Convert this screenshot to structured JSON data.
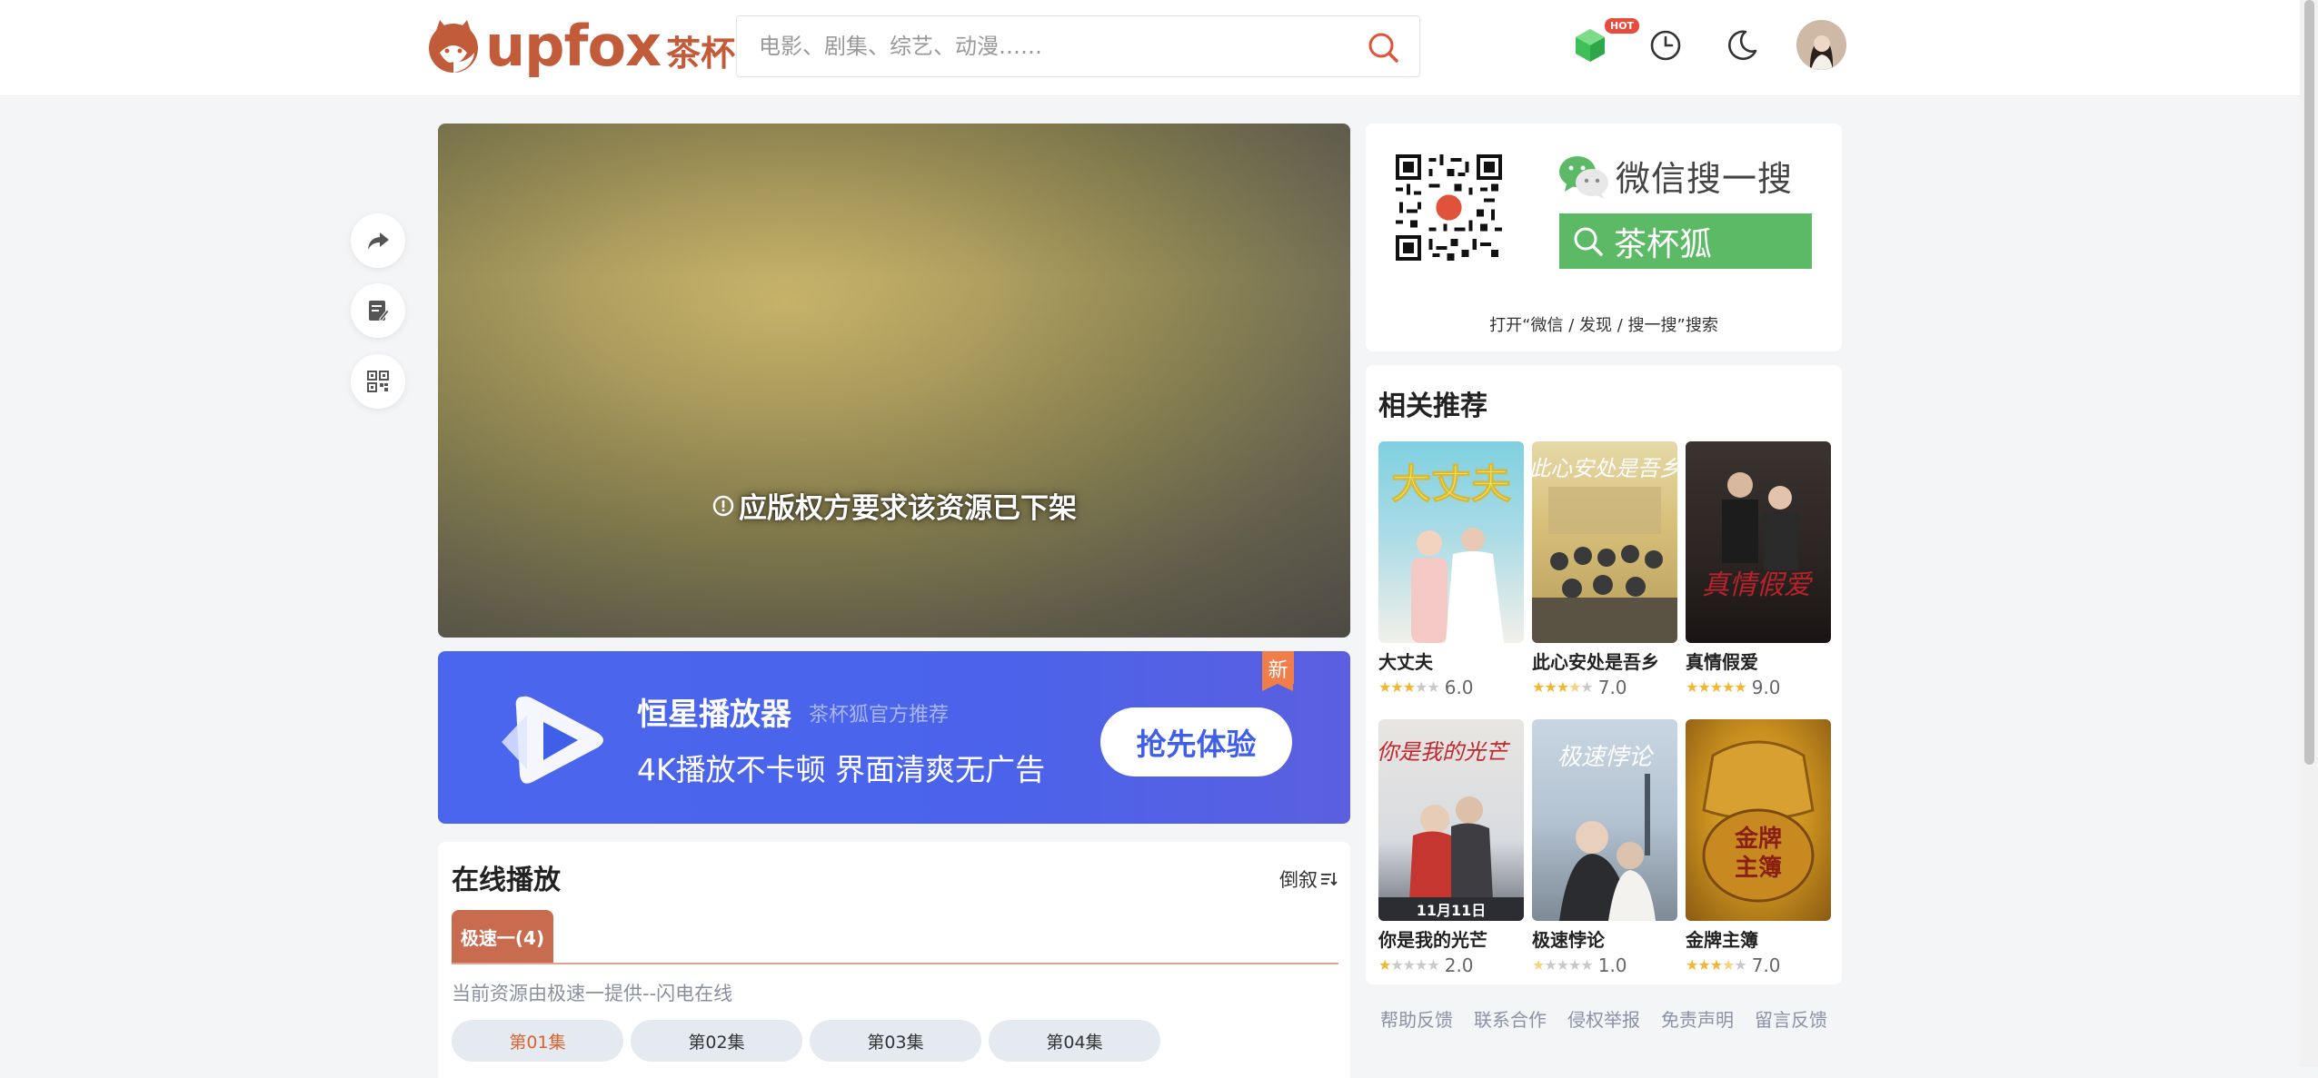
{
  "header": {
    "logo_text": "upfox",
    "logo_cn": "茶杯狐",
    "search_placeholder": "电影、剧集、综艺、动漫……",
    "hot_badge": "HOT"
  },
  "player": {
    "message": "应版权方要求该资源已下架"
  },
  "ad": {
    "title": "恒星播放器",
    "subtitle": "茶杯狐官方推荐",
    "description": "4K播放不卡顿  界面清爽无广告",
    "button": "抢先体验",
    "new_tag": "新"
  },
  "play": {
    "title": "在线播放",
    "sort_label": "倒叙",
    "source_tab": "极速一(4)",
    "source_info": "当前资源由极速一提供--闪电在线",
    "episodes": [
      "第01集",
      "第02集",
      "第03集",
      "第04集"
    ],
    "active_episode": 0
  },
  "wechat": {
    "title": "微信搜一搜",
    "search_text": "茶杯狐",
    "hint": "打开“微信 / 发现 / 搜一搜”搜索"
  },
  "recommend": {
    "title": "相关推荐",
    "items": [
      {
        "name": "大丈夫",
        "score": "6.0",
        "stars": 3
      },
      {
        "name": "此心安处是吾乡",
        "score": "7.0",
        "stars": 3.5
      },
      {
        "name": "真情假爱",
        "score": "9.0",
        "stars": 4.5
      },
      {
        "name": "你是我的光芒",
        "score": "2.0",
        "stars": 1
      },
      {
        "name": "极速悖论",
        "score": "1.0",
        "stars": 0.5
      },
      {
        "name": "金牌主簿",
        "score": "7.0",
        "stars": 3.5
      }
    ]
  },
  "footer": {
    "links": [
      "帮助反馈",
      "联系合作",
      "侵权举报",
      "免责声明",
      "留言反馈"
    ]
  },
  "colors": {
    "brand": "#c25b3a",
    "ad_blue": "#4b66ee",
    "wechat_green": "#5cba66",
    "star": "#f1b632"
  }
}
